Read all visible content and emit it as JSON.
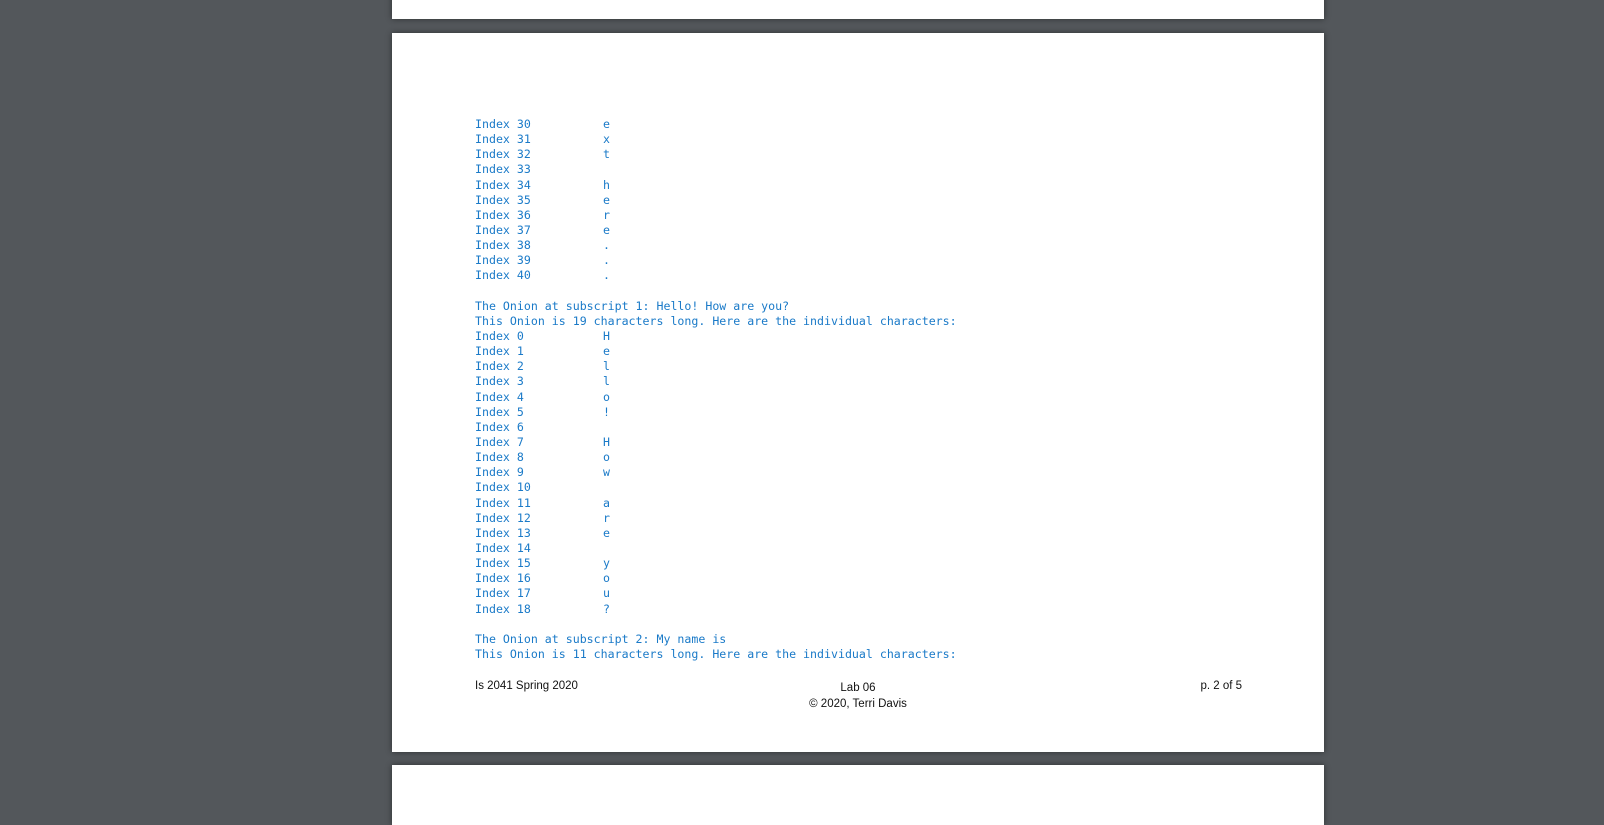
{
  "document": {
    "page": {
      "sections": [
        {
          "header_lines": [],
          "rows": [
            {
              "label": "Index 30",
              "char": "e"
            },
            {
              "label": "Index 31",
              "char": "x"
            },
            {
              "label": "Index 32",
              "char": "t"
            },
            {
              "label": "Index 33",
              "char": ""
            },
            {
              "label": "Index 34",
              "char": "h"
            },
            {
              "label": "Index 35",
              "char": "e"
            },
            {
              "label": "Index 36",
              "char": "r"
            },
            {
              "label": "Index 37",
              "char": "e"
            },
            {
              "label": "Index 38",
              "char": "."
            },
            {
              "label": "Index 39",
              "char": "."
            },
            {
              "label": "Index 40",
              "char": "."
            }
          ]
        },
        {
          "header_lines": [
            "The Onion at subscript 1: Hello! How are you?",
            "This Onion is 19 characters long. Here are the individual characters:"
          ],
          "rows": [
            {
              "label": "Index 0",
              "char": "H"
            },
            {
              "label": "Index 1",
              "char": "e"
            },
            {
              "label": "Index 2",
              "char": "l"
            },
            {
              "label": "Index 3",
              "char": "l"
            },
            {
              "label": "Index 4",
              "char": "o"
            },
            {
              "label": "Index 5",
              "char": "!"
            },
            {
              "label": "Index 6",
              "char": ""
            },
            {
              "label": "Index 7",
              "char": "H"
            },
            {
              "label": "Index 8",
              "char": "o"
            },
            {
              "label": "Index 9",
              "char": "w"
            },
            {
              "label": "Index 10",
              "char": ""
            },
            {
              "label": "Index 11",
              "char": "a"
            },
            {
              "label": "Index 12",
              "char": "r"
            },
            {
              "label": "Index 13",
              "char": "e"
            },
            {
              "label": "Index 14",
              "char": ""
            },
            {
              "label": "Index 15",
              "char": "y"
            },
            {
              "label": "Index 16",
              "char": "o"
            },
            {
              "label": "Index 17",
              "char": "u"
            },
            {
              "label": "Index 18",
              "char": "?"
            }
          ]
        },
        {
          "header_lines": [
            "The Onion at subscript 2: My name is",
            "This Onion is 11 characters long. Here are the individual characters:"
          ],
          "rows": []
        }
      ],
      "footer": {
        "left": "Is 2041 Spring 2020",
        "center_title": "Lab 06",
        "center_copyright": "© 2020, Terri Davis",
        "right": "p. 2 of 5"
      }
    },
    "colors": {
      "code_text": "#1a7ac8",
      "viewer_background": "#53575b",
      "page_background": "#ffffff"
    }
  }
}
